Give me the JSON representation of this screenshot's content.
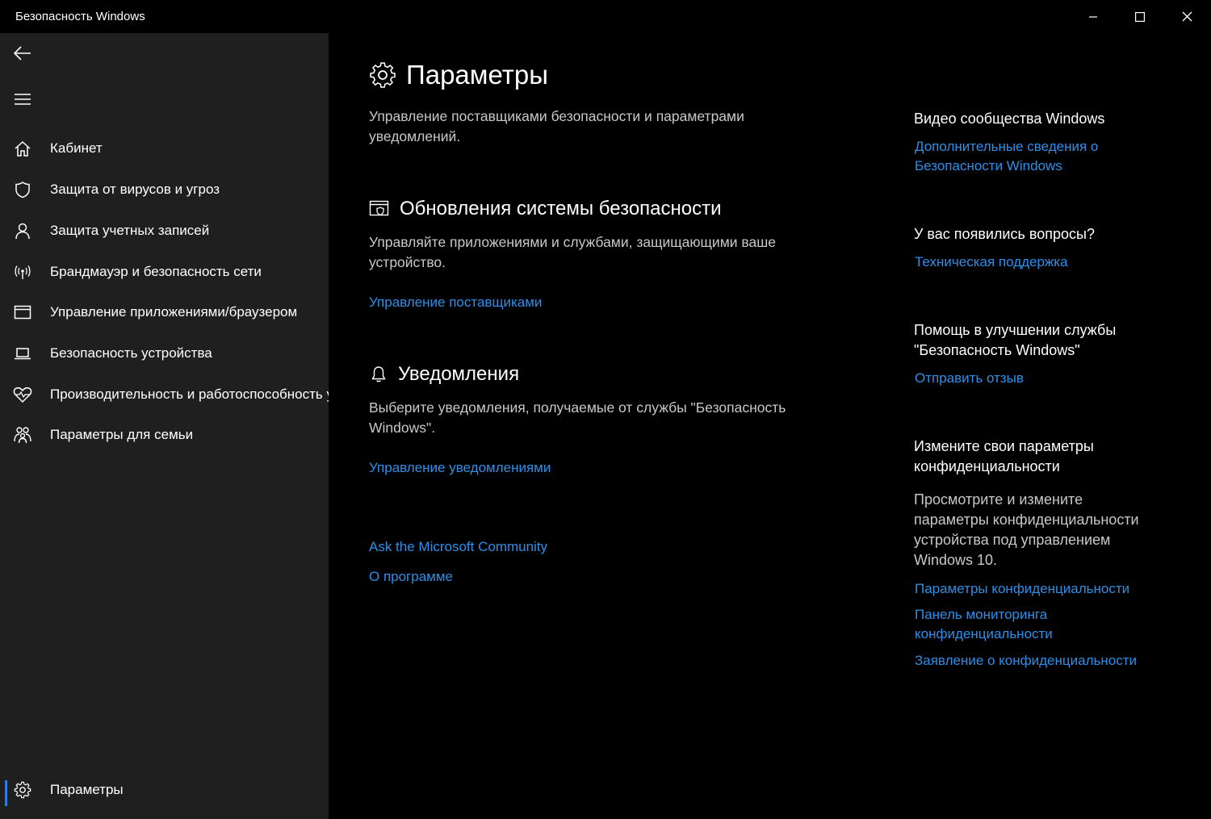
{
  "window": {
    "title": "Безопасность Windows"
  },
  "sidebar": {
    "items": [
      {
        "label": "Кабинет",
        "icon": "home-icon"
      },
      {
        "label": "Защита от вирусов и угроз",
        "icon": "shield-icon"
      },
      {
        "label": "Защита учетных записей",
        "icon": "person-icon"
      },
      {
        "label": "Брандмауэр и безопасность сети",
        "icon": "wireless-icon"
      },
      {
        "label": "Управление приложениями/браузером",
        "icon": "app-window-icon"
      },
      {
        "label": "Безопасность устройства",
        "icon": "laptop-icon"
      },
      {
        "label": "Производительность и работоспособность устройства",
        "icon": "heart-icon"
      },
      {
        "label": "Параметры для семьи",
        "icon": "family-icon"
      }
    ],
    "settings": {
      "label": "Параметры",
      "icon": "gear-icon",
      "active": true
    }
  },
  "main": {
    "title": "Параметры",
    "description": "Управление поставщиками безопасности и параметрами уведомлений.",
    "sections": [
      {
        "title": "Обновления системы безопасности",
        "icon": "security-providers-icon",
        "description": "Управляйте приложениями и службами, защищающими ваше устройство.",
        "link": "Управление поставщиками"
      },
      {
        "title": "Уведомления",
        "icon": "bell-icon",
        "description": "Выберите уведомления, получаемые от службы \"Безопасность Windows\".",
        "link": "Управление уведомлениями"
      }
    ],
    "footer_links": [
      "Ask the Microsoft Community",
      "О программе"
    ]
  },
  "right": {
    "video": {
      "heading": "Видео сообщества Windows",
      "link": "Дополнительные сведения о Безопасности Windows"
    },
    "questions": {
      "heading": "У вас появились вопросы?",
      "link": "Техническая поддержка"
    },
    "feedback": {
      "heading": "Помощь в улучшении службы \"Безопасность Windows\"",
      "link": "Отправить отзыв"
    },
    "privacy": {
      "heading": "Измените свои параметры конфиденциальности",
      "text": "Просмотрите и измените параметры конфиденциальности устройства под управлением Windows 10.",
      "links": [
        "Параметры конфиденциальности",
        "Панель мониторинга конфиденциальности",
        "Заявление о конфиденциальности"
      ]
    }
  },
  "colors": {
    "background": "#000000",
    "sidebar": "#1f1f1f",
    "accent": "#2d8fe8",
    "text_muted": "#c8c8c8"
  }
}
